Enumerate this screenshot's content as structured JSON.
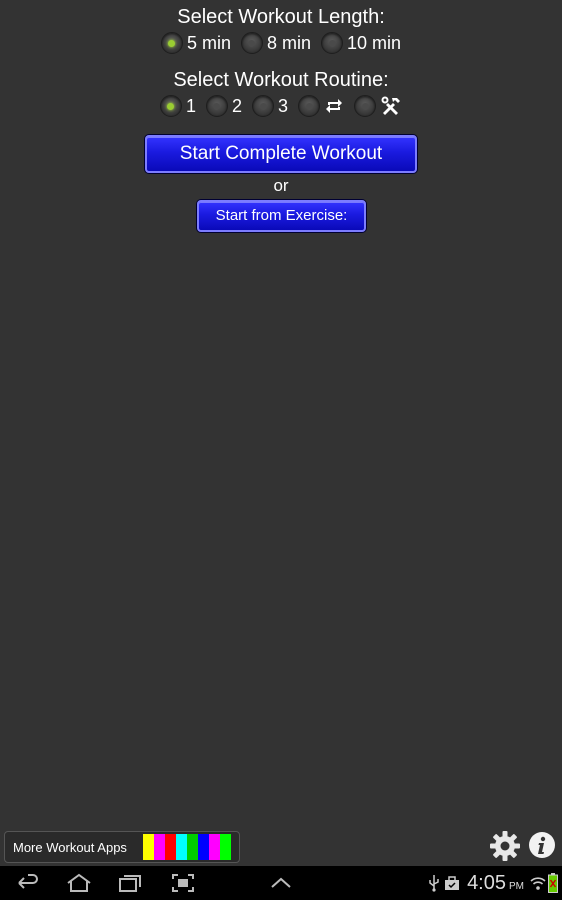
{
  "workout_length": {
    "heading": "Select Workout Length:",
    "options": [
      {
        "label": "5 min",
        "selected": true
      },
      {
        "label": "8 min",
        "selected": false
      },
      {
        "label": "10 min",
        "selected": false
      }
    ]
  },
  "workout_routine": {
    "heading": "Select Workout Routine:",
    "options": [
      {
        "label": "1",
        "selected": true
      },
      {
        "label": "2",
        "selected": false
      },
      {
        "label": "3",
        "selected": false
      },
      {
        "icon": "repeat-icon",
        "selected": false
      },
      {
        "icon": "tools-icon",
        "selected": false
      }
    ]
  },
  "buttons": {
    "start_complete": "Start Complete Workout",
    "or": "or",
    "start_from_exercise": "Start from Exercise:"
  },
  "footer": {
    "more_apps_label": "More Workout Apps",
    "app_swatch_colors": [
      "#ffff00",
      "#ff00ff",
      "#ff0000",
      "#00ffff",
      "#00cc00",
      "#0000ff",
      "#ff00ff",
      "#00ff00"
    ],
    "settings_icon": "gear-icon",
    "info_icon": "info-icon"
  },
  "system_bar": {
    "time": "4:05",
    "ampm": "PM",
    "nav_icons": [
      "back-icon",
      "home-icon",
      "recent-apps-icon",
      "screenshot-icon",
      "menu-up-icon"
    ],
    "status_icons": [
      "usb-icon",
      "bag-icon",
      "wifi-icon",
      "battery-icon"
    ]
  },
  "colors": {
    "background": "#333333",
    "button_blue": "#1a1adf",
    "radio_selected": "#9acd32"
  }
}
